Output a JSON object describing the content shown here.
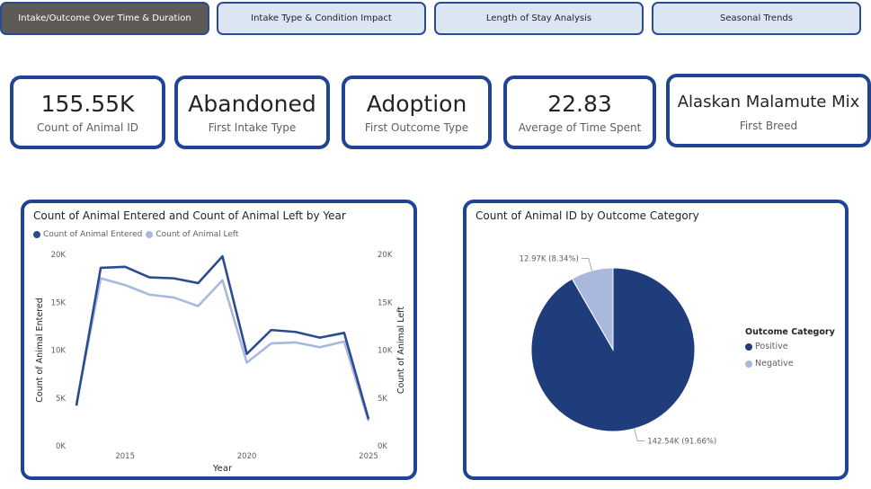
{
  "tabs": [
    {
      "label": "Intake/Outcome Over Time & Duration",
      "active": true
    },
    {
      "label": "Intake Type & Condition Impact",
      "active": false
    },
    {
      "label": "Length of Stay Analysis",
      "active": false
    },
    {
      "label": "Seasonal Trends",
      "active": false
    }
  ],
  "kpis": [
    {
      "value": "155.55K",
      "label": "Count of Animal ID"
    },
    {
      "value": "Abandoned",
      "label": "First Intake Type"
    },
    {
      "value": "Adoption",
      "label": "First Outcome Type"
    },
    {
      "value": "22.83",
      "label": "Average of Time Spent"
    },
    {
      "value": "Alaskan Malamute Mix",
      "label": "First Breed"
    }
  ],
  "line_chart": {
    "title": "Count of Animal Entered and Count of Animal Left by Year",
    "legend": [
      "Count of Animal Entered",
      "Count of Animal Left"
    ],
    "colors": [
      "#2a4c93",
      "#a9b9de"
    ],
    "y_left_label": "Count of Animal Entered",
    "y_right_label": "Count of Animal Left",
    "x_label": "Year",
    "y_ticks": [
      "0K",
      "5K",
      "10K",
      "15K",
      "20K"
    ],
    "x_ticks": [
      "2015",
      "2020",
      "2025"
    ]
  },
  "pie_chart": {
    "title": "Count of Animal ID by Outcome Category",
    "legend_title": "Outcome Category",
    "legend": [
      "Positive",
      "Negative"
    ],
    "colors": [
      "#1f3d7a",
      "#a9b9de"
    ],
    "labels": [
      "142.54K (91.66%)",
      "12.97K (8.34%)"
    ]
  },
  "chart_data": [
    {
      "type": "line",
      "title": "Count of Animal Entered and Count of Animal Left by Year",
      "xlabel": "Year",
      "ylabel": "Count of Animal Entered",
      "y2label": "Count of Animal Left",
      "x": [
        2013,
        2014,
        2015,
        2016,
        2017,
        2018,
        2019,
        2020,
        2021,
        2022,
        2023,
        2024,
        2025
      ],
      "series": [
        {
          "name": "Count of Animal Entered",
          "values": [
            4200,
            18600,
            18700,
            17600,
            17500,
            17000,
            19800,
            9600,
            12100,
            11900,
            11300,
            11800,
            2800
          ]
        },
        {
          "name": "Count of Animal Left",
          "values": [
            4400,
            17500,
            16800,
            15800,
            15500,
            14600,
            17300,
            8700,
            10700,
            10800,
            10300,
            10900,
            2600
          ]
        }
      ],
      "ylim": [
        0,
        20000
      ],
      "legend": "top-left"
    },
    {
      "type": "pie",
      "title": "Count of Animal ID by Outcome Category",
      "categories": [
        "Positive",
        "Negative"
      ],
      "values": [
        142540,
        12970
      ],
      "percents": [
        91.66,
        8.34
      ],
      "legend": "right"
    }
  ]
}
